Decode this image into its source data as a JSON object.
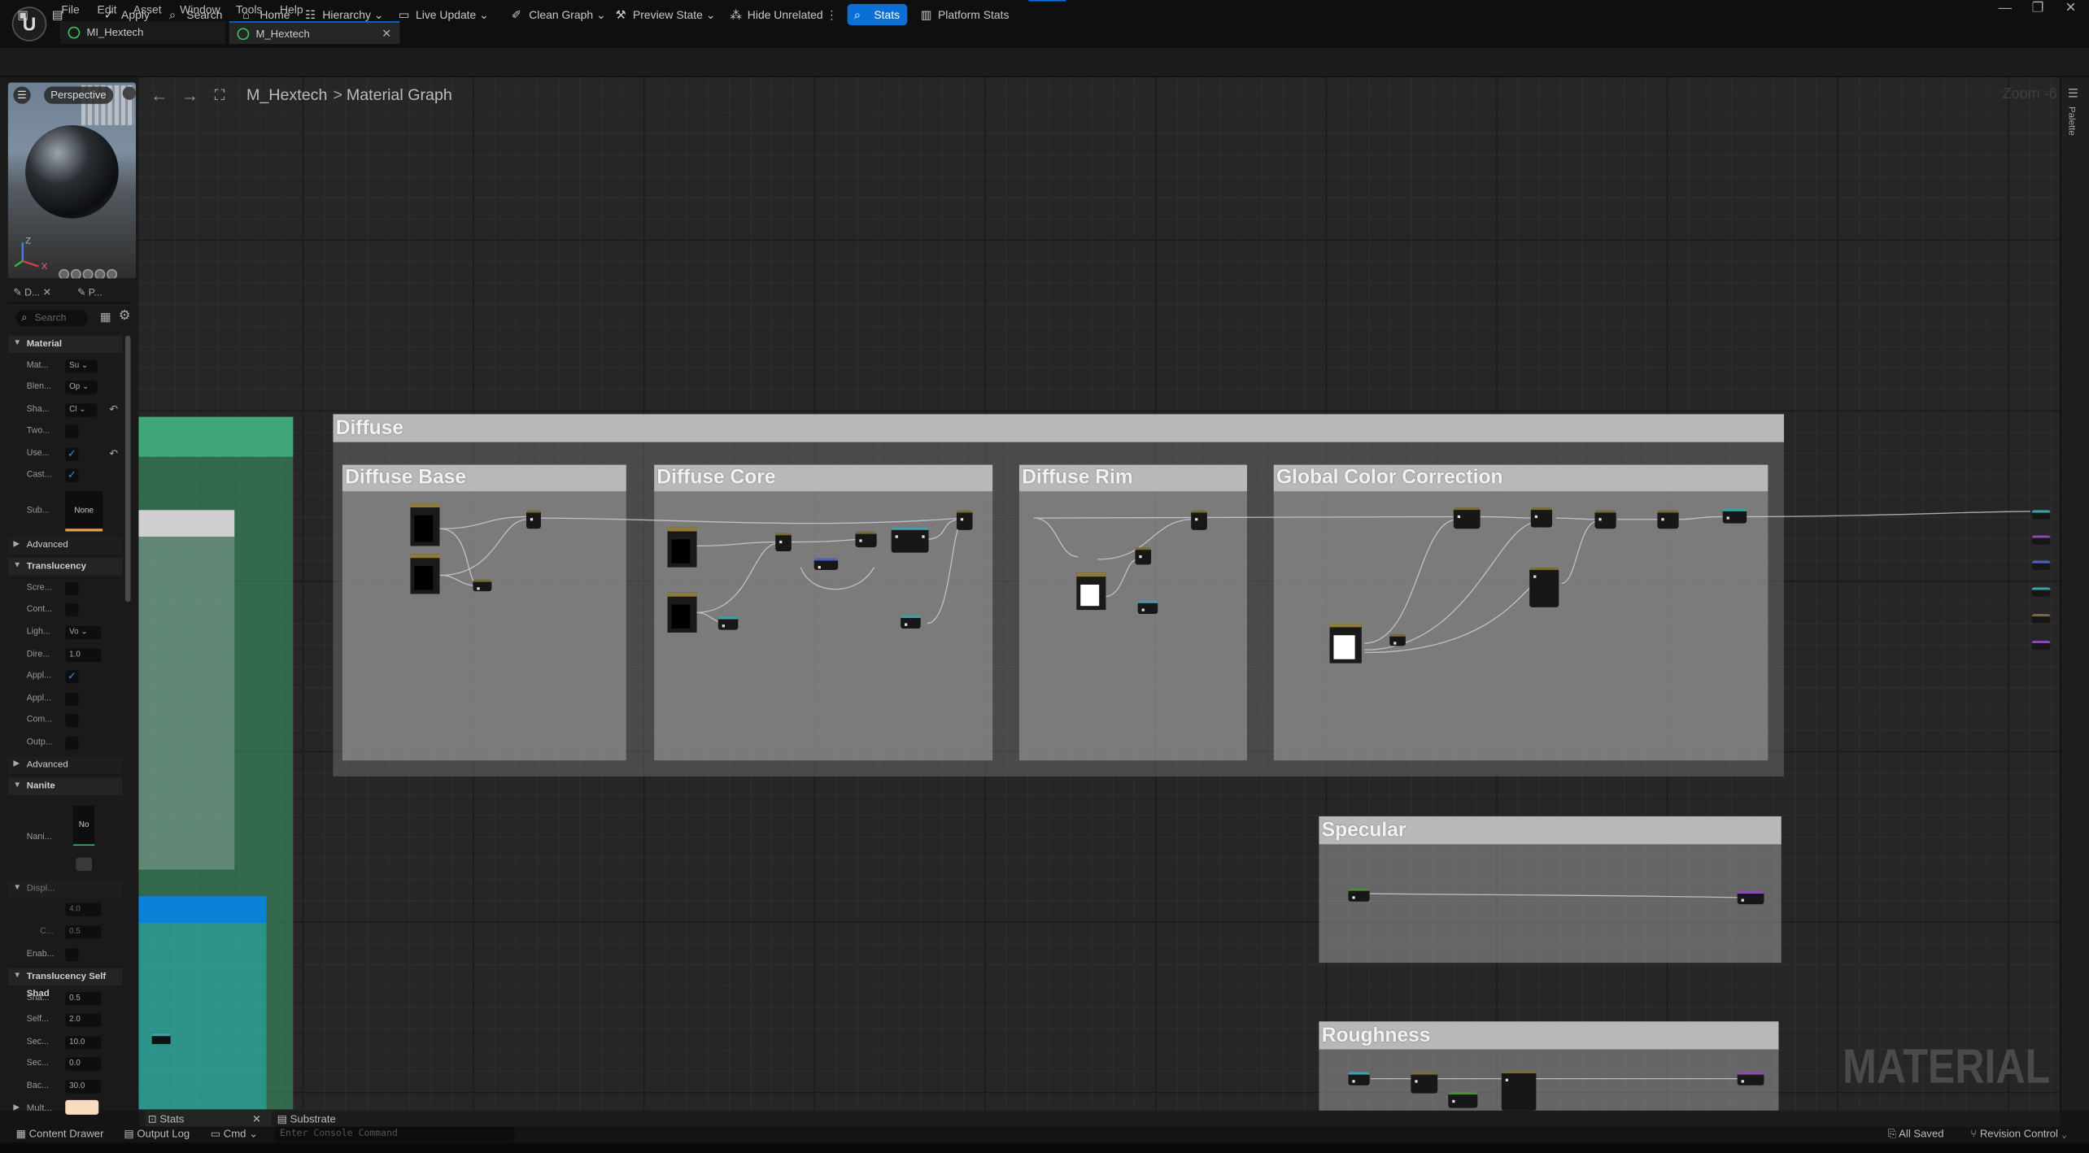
{
  "app": {
    "logo_letter": "U",
    "window_controls": [
      "—",
      "❐",
      "✕"
    ]
  },
  "menu": [
    "File",
    "Edit",
    "Asset",
    "Window",
    "Tools",
    "Help"
  ],
  "tabs": [
    {
      "label": "MI_Hextech"
    },
    {
      "label": "M_Hextech",
      "close": "✕"
    }
  ],
  "toolbar": {
    "apply": "Apply",
    "search": "Search",
    "home": "Home",
    "hierarchy": "Hierarchy",
    "live_update": "Live Update",
    "clean_graph": "Clean Graph",
    "preview_state": "Preview State",
    "hide_unrelated": "Hide Unrelated",
    "stats": "Stats",
    "platform_stats": "Platform Stats"
  },
  "viewport": {
    "mode": "Perspective"
  },
  "panel_tabs": {
    "details": "D...",
    "details_close": "✕",
    "palette": "P..."
  },
  "details": {
    "search_placeholder": "Search",
    "sections": {
      "material": "Material",
      "advanced1": "Advanced",
      "translucency": "Translucency",
      "advanced2": "Advanced",
      "nanite": "Nanite",
      "displ": "Displ...",
      "self_shadow": "Translucency Self Shad"
    },
    "props": {
      "mat": "Mat...",
      "mat_val": "Su",
      "blend": "Blen...",
      "blend_val": "Op",
      "shading": "Sha...",
      "shading_val": "Cl",
      "two": "Two...",
      "use": "Use...",
      "cast": "Cast...",
      "sub": "Sub...",
      "sub_val": "None",
      "scre": "Scre...",
      "cont": "Cont...",
      "ligh": "Ligh...",
      "ligh_val": "Vo",
      "dire": "Dire...",
      "dire_val": "1.0",
      "appl1": "Appl...",
      "appl2": "Appl...",
      "com": "Com...",
      "outp": "Outp...",
      "nani": "Nani...",
      "nani_val": "No",
      "displ_a": "4.0",
      "displ_c": "C...",
      "displ_c_val": "0.5",
      "enab": "Enab...",
      "sha2": "Sha...",
      "sha2_val": "0.5",
      "self": "Self...",
      "self_val": "2.0",
      "sec1": "Sec...",
      "sec1_val": "10.0",
      "sec2": "Sec...",
      "sec2_val": "0.0",
      "bac": "Bac...",
      "bac_val": "30.0",
      "mult": "Mult..."
    }
  },
  "graph": {
    "breadcrumb_asset": "M_Hextech",
    "breadcrumb_sep": ">",
    "breadcrumb_graph": "Material Graph",
    "zoom": "Zoom -6",
    "watermark": "MATERIAL",
    "comments": {
      "diffuse": "Diffuse",
      "diffuse_base": "Diffuse Base",
      "diffuse_core": "Diffuse Core",
      "diffuse_rim": "Diffuse Rim",
      "global_cc": "Global Color Correction",
      "specular": "Specular",
      "roughness": "Roughness"
    }
  },
  "palette": {
    "label": "Palette"
  },
  "bottom": {
    "stats_tab": "Stats",
    "stats_close": "✕",
    "substrate_tab": "Substrate",
    "content_drawer": "Content Drawer",
    "output_log": "Output Log",
    "cmd": "Cmd",
    "console_placeholder": "Enter Console Command",
    "all_saved": "All Saved",
    "revision_control": "Revision Control"
  },
  "colors": {
    "accent": "#0a70d8",
    "comment_header": "#b8b8b8",
    "left_green": "#3a9a6a",
    "left_blue": "#0a7ed0"
  }
}
